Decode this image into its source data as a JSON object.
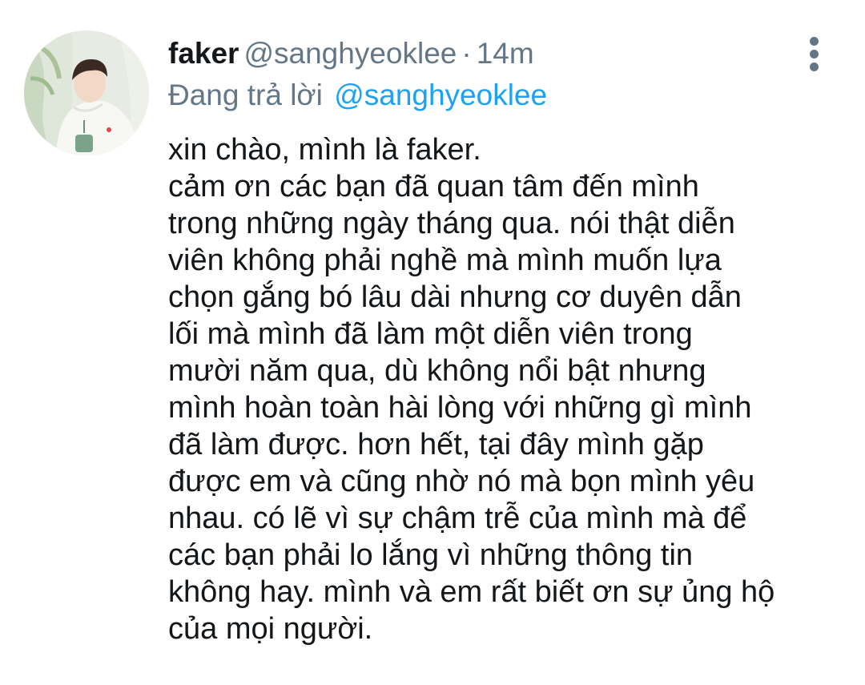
{
  "author": {
    "display_name": "faker",
    "handle": "@sanghyeoklee",
    "separator": "·",
    "timestamp": "14m"
  },
  "reply": {
    "prefix": "Đang trả lời",
    "handle": "@sanghyeoklee"
  },
  "more_icon": "more-vertical-icon",
  "body_lines": [
    "xin chào, mình là faker.",
    "cảm ơn các bạn đã quan tâm đến mình",
    "trong những ngày tháng qua. nói thật diễn",
    "viên không phải nghề mà mình muốn lựa",
    "chọn gắng bó lâu dài nhưng cơ duyên dẫn",
    "lối mà mình đã làm một diễn viên trong",
    "mười năm qua, dù không nổi bật nhưng",
    "mình hoàn toàn hài lòng với những gì mình",
    "đã làm được. hơn hết, tại đây mình gặp",
    "được em và cũng nhờ nó mà bọn mình yêu",
    "nhau. có lẽ vì sự chậm trễ của mình mà để",
    "các bạn phải lo lắng vì những thông tin",
    "không hay. mình và em rất biết ơn sự ủng hộ",
    "của mọi người."
  ],
  "colors": {
    "text": "#14171a",
    "secondary": "#657786",
    "link": "#1da1f2",
    "background": "#ffffff"
  }
}
